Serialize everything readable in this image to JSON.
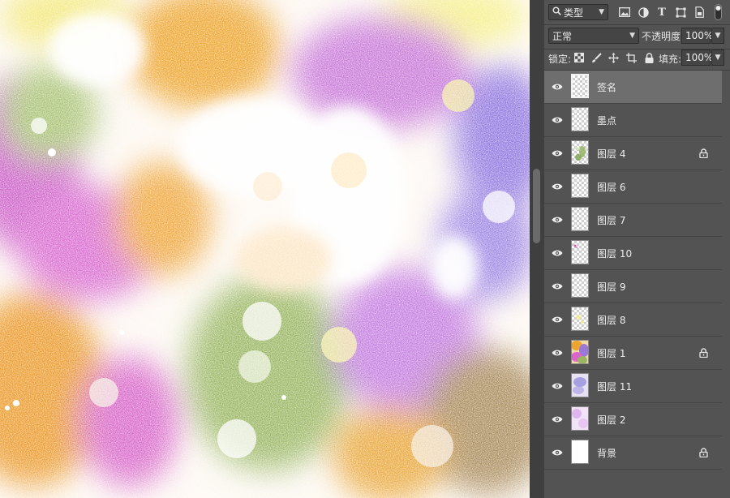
{
  "panel": {
    "filter": {
      "label": "类型",
      "icon": "search-icon"
    },
    "filter_icons": [
      "image-filter-icon",
      "adjustment-filter-icon",
      "text-filter-icon",
      "shape-filter-icon",
      "smart-object-filter-icon",
      "filter-toggle-icon"
    ],
    "blend_mode": "正常",
    "opacity_label": "不透明度:",
    "opacity_value": "100%",
    "lock_label": "锁定:",
    "lock_icons": [
      "lock-transparent-icon",
      "lock-image-icon",
      "lock-position-icon",
      "lock-artboard-icon",
      "lock-all-icon"
    ],
    "fill_label": "填充:",
    "fill_value": "100%"
  },
  "layers": [
    {
      "name": "签名",
      "selected": true,
      "locked": false,
      "thumb": "transparent"
    },
    {
      "name": "墨点",
      "selected": false,
      "locked": false,
      "thumb": "transparent"
    },
    {
      "name": "图层 4",
      "selected": false,
      "locked": true,
      "thumb": "leaf"
    },
    {
      "name": "图层 6",
      "selected": false,
      "locked": false,
      "thumb": "transparent"
    },
    {
      "name": "图层 7",
      "selected": false,
      "locked": false,
      "thumb": "transparent"
    },
    {
      "name": "图层 10",
      "selected": false,
      "locked": false,
      "thumb": "pink-dot"
    },
    {
      "name": "图层 9",
      "selected": false,
      "locked": false,
      "thumb": "transparent"
    },
    {
      "name": "图层 8",
      "selected": false,
      "locked": false,
      "thumb": "yellow-dots"
    },
    {
      "name": "图层 1",
      "selected": false,
      "locked": true,
      "thumb": "painting"
    },
    {
      "name": "图层 11",
      "selected": false,
      "locked": false,
      "thumb": "blue-texture"
    },
    {
      "name": "图层 2",
      "selected": false,
      "locked": false,
      "thumb": "violet-wash"
    },
    {
      "name": "背景",
      "selected": false,
      "locked": true,
      "thumb": "white"
    }
  ],
  "colors": {
    "panel_bg": "#535353",
    "selected_row": "#6e6e6e",
    "canvas_orange": "#eea52f",
    "canvas_magenta": "#cc66cc",
    "canvas_purple": "#9a78d8",
    "canvas_green": "#9cb565",
    "canvas_yellow": "#f6f08a"
  }
}
